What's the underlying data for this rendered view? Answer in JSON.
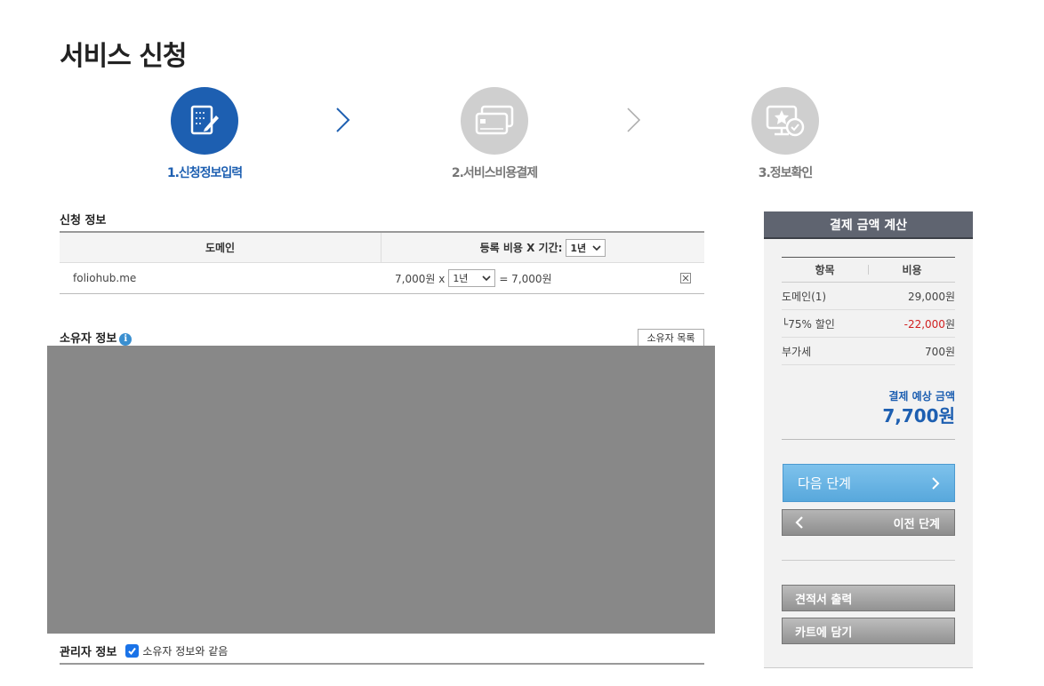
{
  "page": {
    "title": "서비스 신청"
  },
  "steps": [
    {
      "label": "1.신청정보입력",
      "icon": "edit-document-icon",
      "active": true
    },
    {
      "label": "2.서비스비용결제",
      "icon": "credit-card-icon",
      "active": false
    },
    {
      "label": "3.정보확인",
      "icon": "monitor-star-check-icon",
      "active": false
    }
  ],
  "apply": {
    "section_title": "신청 정보",
    "col_domain": "도메인",
    "col_cost": "등록 비용 X 기간:",
    "period_header_value": "1년",
    "rows": [
      {
        "domain": "foliohub.me",
        "unit_price": "7,000원 x",
        "period": "1년",
        "total": "= 7,000원"
      }
    ]
  },
  "owner": {
    "section_title": "소유자 정보",
    "list_button": "소유자 목록"
  },
  "admin": {
    "section_title": "관리자 정보",
    "same_as_owner": "소유자 정보와 같음",
    "same_checked": true
  },
  "calc": {
    "title": "결제 금액 계산",
    "col_item": "항목",
    "col_cost": "비용",
    "rows": [
      {
        "label": "도메인(1)",
        "value": "29,000원",
        "negative": false
      },
      {
        "label": "└75% 할인",
        "value": "-22,000",
        "unit": "원",
        "negative": true
      },
      {
        "label": "부가세",
        "value": "700원",
        "negative": false
      }
    ],
    "total_label": "결제 예상 금액",
    "total_value": "7,700원"
  },
  "buttons": {
    "next": "다음 단계",
    "prev": "이전 단계",
    "print": "견적서 출력",
    "cart": "카트에 담기"
  },
  "colors": {
    "accent": "#1d5fb1",
    "inactive_step": "#cfcfcf",
    "panel_head": "#5f6470",
    "negative": "#d02020",
    "next_button": "#6cb6e4"
  }
}
